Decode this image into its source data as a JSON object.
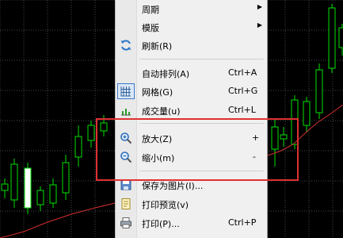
{
  "colors": {
    "background": "#000000",
    "grid": "#44474b",
    "candle_up": "#00e000",
    "candle_fill": "#ffffff",
    "moving_average": "#d23030",
    "menu_bg": "#f0f0f0",
    "highlight": "#e03030"
  },
  "menu": {
    "items": [
      {
        "label": "周期",
        "shortcut": "",
        "submenu": true,
        "icon": ""
      },
      {
        "label": "模版",
        "shortcut": "",
        "submenu": true,
        "icon": ""
      },
      {
        "label": "刷新(R)",
        "shortcut": "",
        "submenu": false,
        "icon": "refresh-icon"
      },
      {
        "label": "自动排列(A)",
        "shortcut": "Ctrl+A",
        "submenu": false,
        "icon": ""
      },
      {
        "label": "网格(G)",
        "shortcut": "Ctrl+G",
        "submenu": false,
        "icon": "grid-icon"
      },
      {
        "label": "成交量(u)",
        "shortcut": "Ctrl+L",
        "submenu": false,
        "icon": "volume-icon"
      },
      {
        "label": "放大(Z)",
        "shortcut": "+",
        "submenu": false,
        "icon": "zoom-in-icon"
      },
      {
        "label": "缩小(m)",
        "shortcut": "-",
        "submenu": false,
        "icon": "zoom-out-icon"
      },
      {
        "label": "保存为图片(I)...",
        "shortcut": "",
        "submenu": false,
        "icon": "save-image-icon"
      },
      {
        "label": "打印预览(v)",
        "shortcut": "",
        "submenu": false,
        "icon": "print-preview-icon"
      },
      {
        "label": "打印(P)...",
        "shortcut": "Ctrl+P",
        "submenu": false,
        "icon": "print-icon"
      }
    ]
  }
}
